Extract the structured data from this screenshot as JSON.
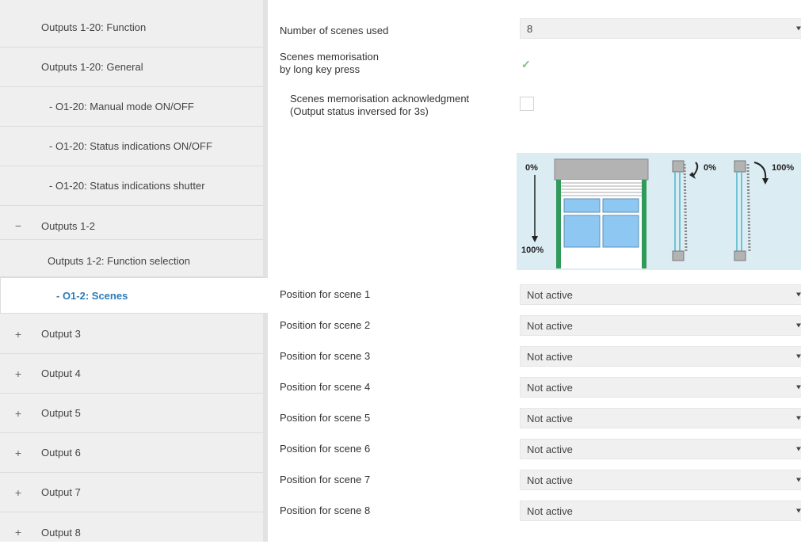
{
  "sidebar": {
    "items": [
      {
        "label": "Outputs 1-20: Function",
        "prefix": ""
      },
      {
        "label": "Outputs 1-20: General",
        "prefix": ""
      },
      {
        "label": "- O1-20: Manual mode ON/OFF",
        "prefix": ""
      },
      {
        "label": "- O1-20: Status indications ON/OFF",
        "prefix": ""
      },
      {
        "label": "- O1-20: Status indications shutter",
        "prefix": ""
      },
      {
        "label": "Outputs 1-2",
        "prefix": "−"
      },
      {
        "label": "Outputs 1-2: Function selection",
        "prefix": ""
      },
      {
        "label": "- O1-2: Scenes",
        "prefix": ""
      },
      {
        "label": "Output 3",
        "prefix": "+"
      },
      {
        "label": "Output 4",
        "prefix": "+"
      },
      {
        "label": "Output 5",
        "prefix": "+"
      },
      {
        "label": "Output 6",
        "prefix": "+"
      },
      {
        "label": "Output 7",
        "prefix": "+"
      },
      {
        "label": "Output 8",
        "prefix": "+"
      }
    ]
  },
  "main": {
    "num_scenes": {
      "label": "Number of scenes used",
      "value": "8"
    },
    "memorisation": {
      "line1": "Scenes memorisation",
      "line2": "by long key press",
      "checked": true
    },
    "acknowledgment": {
      "line1": "Scenes memorisation acknowledgment",
      "line2": "(Output status inversed for 3s)",
      "checked": false
    },
    "diagram": {
      "top_left": "0%",
      "bottom_left": "100%",
      "slat_open": "0%",
      "slat_closed": "100%"
    },
    "scenes": [
      {
        "label": "Position for scene 1",
        "value": "Not active"
      },
      {
        "label": "Position for scene 2",
        "value": "Not active"
      },
      {
        "label": "Position for scene 3",
        "value": "Not active"
      },
      {
        "label": "Position for scene 4",
        "value": "Not active"
      },
      {
        "label": "Position for scene 5",
        "value": "Not active"
      },
      {
        "label": "Position for scene 6",
        "value": "Not active"
      },
      {
        "label": "Position for scene 7",
        "value": "Not active"
      },
      {
        "label": "Position for scene 8",
        "value": "Not active"
      }
    ]
  },
  "colors": {
    "active_text": "#2e7bb6",
    "sidebar_bg": "#efefef",
    "diagram_bg": "#dcecf3",
    "frame_green": "#2f9a5a",
    "glass_blue": "#8ec8f2"
  }
}
